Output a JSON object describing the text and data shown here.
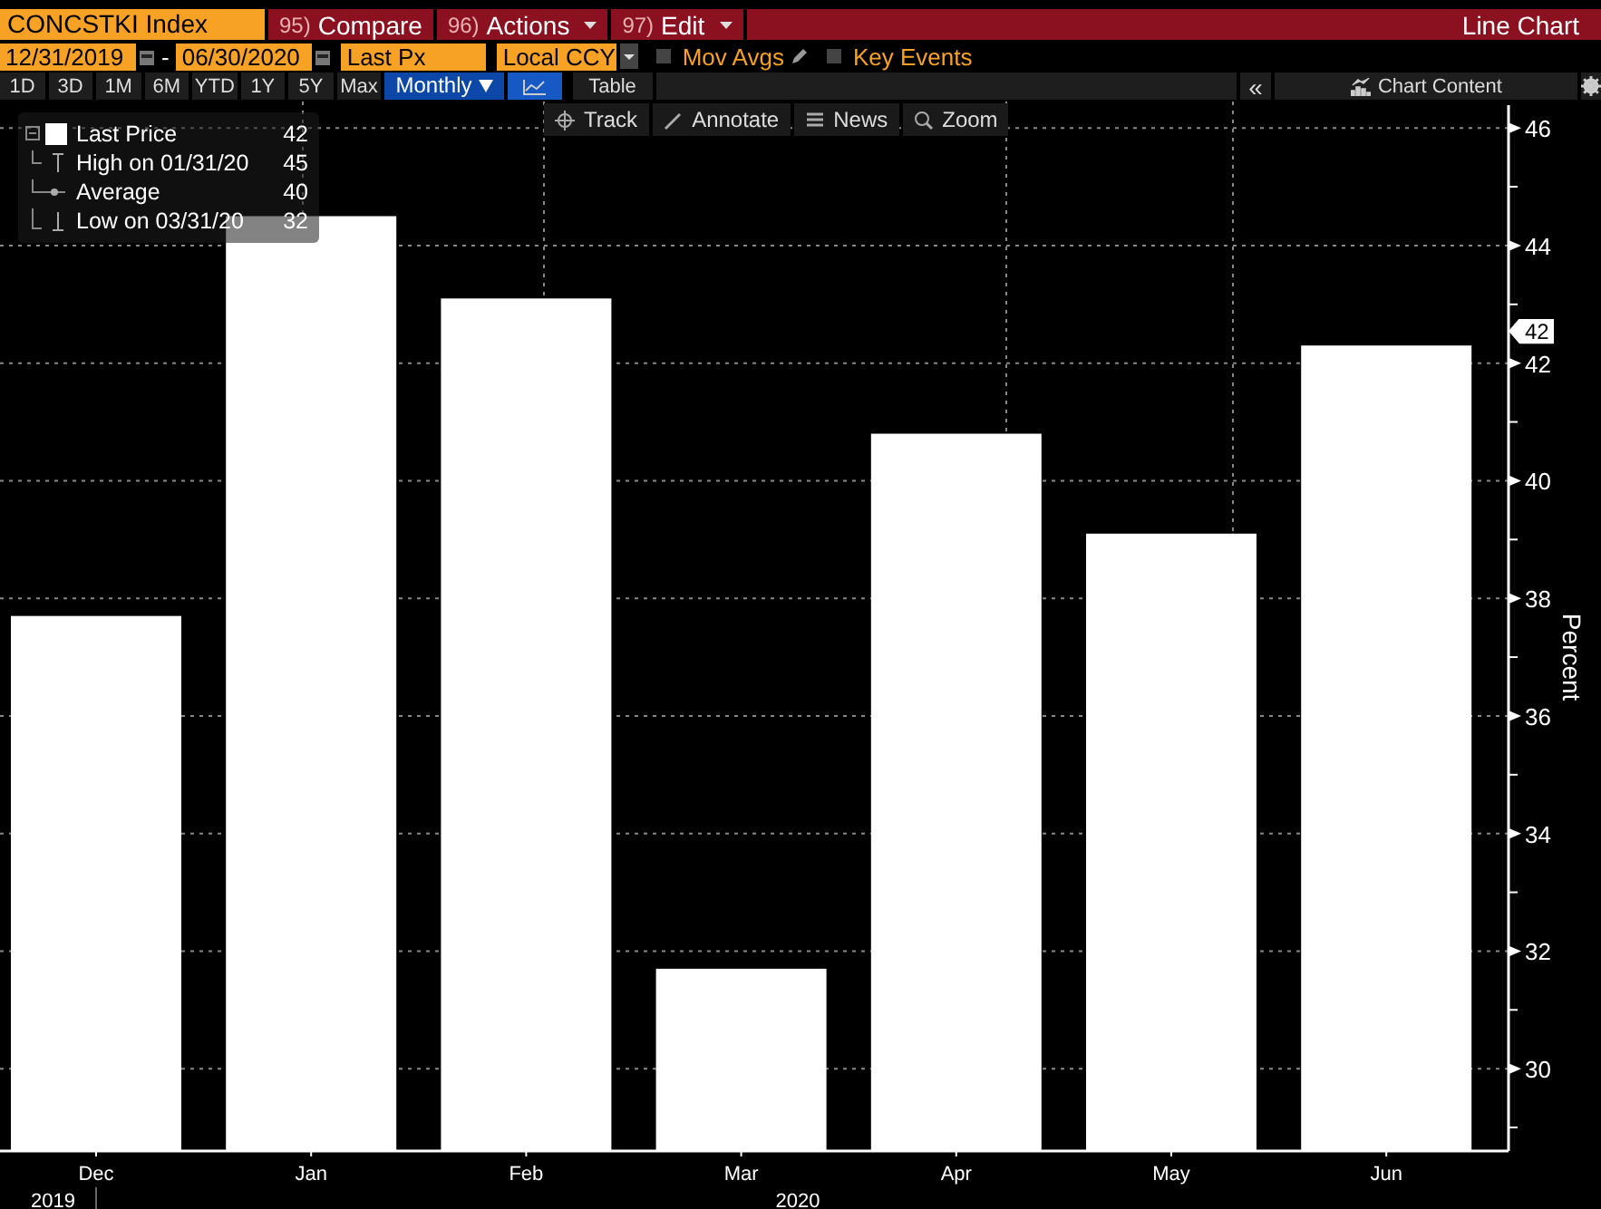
{
  "header": {
    "security": "CONCSTKI Index",
    "menus": [
      {
        "number": "95)",
        "label": "Compare",
        "dropdown": false
      },
      {
        "number": "96)",
        "label": "Actions",
        "dropdown": true
      },
      {
        "number": "97)",
        "label": "Edit",
        "dropdown": true
      }
    ],
    "title": "Line Chart"
  },
  "settings": {
    "start_date": "12/31/2019",
    "separator": "-",
    "end_date": "06/30/2020",
    "field": "Last Px",
    "currency": "Local CCY",
    "options": [
      {
        "label": "Mov Avgs",
        "checked": false,
        "kind": "pencil"
      },
      {
        "label": "Key Events",
        "checked": false,
        "kind": "plain"
      }
    ]
  },
  "periods": [
    {
      "label": "1D",
      "selected": false
    },
    {
      "label": "3D",
      "selected": false
    },
    {
      "label": "1M",
      "selected": false
    },
    {
      "label": "6M",
      "selected": false
    },
    {
      "label": "YTD",
      "selected": false
    },
    {
      "label": "1Y",
      "selected": false
    },
    {
      "label": "5Y",
      "selected": false
    },
    {
      "label": "Max",
      "selected": false
    }
  ],
  "frequency": "Monthly",
  "table_tab": "Table",
  "collapse": "«",
  "chart_content": "Chart Content",
  "tools": [
    "Track",
    "Annotate",
    "News",
    "Zoom"
  ],
  "legend": [
    {
      "kind": "swatch",
      "value": "42"
    },
    {
      "kind": "high",
      "label": "High on 01/31/20",
      "value": "45"
    },
    {
      "kind": "average",
      "label": "Average",
      "value": "40"
    },
    {
      "kind": "low",
      "label": "Low on 03/31/20",
      "value": "32"
    }
  ],
  "last_marker": "42",
  "years": [
    "2019",
    "2020"
  ],
  "chart_data": {
    "type": "bar",
    "ylabel": "Percent",
    "categories": [
      "Dec",
      "Jan",
      "Feb",
      "Mar",
      "Apr",
      "May",
      "Jun"
    ],
    "series": [
      {
        "name": "Last Price",
        "color": "#ffffff",
        "values": [
          37.7,
          44.5,
          43.1,
          31.7,
          40.8,
          39.1,
          42.3
        ]
      }
    ],
    "grid": true,
    "ylim": [
      28.6,
      46.45
    ],
    "yticks": [
      30,
      32,
      34,
      36,
      38,
      40,
      42,
      44,
      46
    ]
  }
}
